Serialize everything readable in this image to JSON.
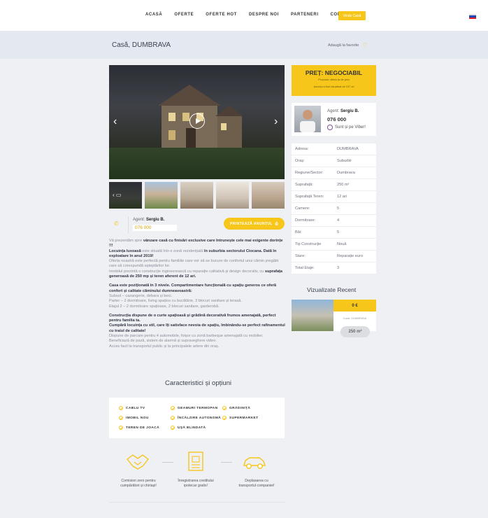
{
  "nav": {
    "items": [
      "ACASĂ",
      "OFERTE",
      "OFERTE HOT",
      "DESPRE NOI",
      "PARTENERI",
      "CONTACTE"
    ],
    "sell_button": "Vinde Casă",
    "flag_colors": [
      "#ffffff",
      "#1a47b8",
      "#e21c26"
    ]
  },
  "title": {
    "heading": "Casă, DUMBRAVA",
    "favorite_label": "Adaugă la favorite"
  },
  "agent": {
    "label": "Agent:",
    "name": "Sergiu B.",
    "phone": "076 000",
    "print_label": "PRINTEAZĂ ANUNȚUL"
  },
  "description": {
    "p1": [
      {
        "t": "Vă prezentăm spre ",
        "b": false
      },
      {
        "t": "vânzare casă cu finisări exclusive care întrunește cele mai exigente dorințe !!!",
        "b": true
      },
      {
        "t": "Locuința luxoasă",
        "b": true,
        "br": true
      },
      {
        "t": " este situată într-o zonă rezidențială ",
        "b": false
      },
      {
        "t": "în suburbia sectorului Ciocana. Dată în exploatare în anul 2019!",
        "b": true
      },
      {
        "t": "Oferta noastră este perfectă pentru familiile care vor să se bucure de confortul unui cămin pregătit care să corespundă așteptărilor lor.",
        "b": false,
        "br": true
      },
      {
        "t": "Imobilul prezintă o construcție ingineerească cu reparație calitativă și design decorativ, cu ",
        "b": false,
        "br": true
      },
      {
        "t": "suprafața generoasă de 250 mp și teren aferent de 12 ari.",
        "b": true
      }
    ],
    "p2": [
      {
        "t": "Casa este poziționată în 3 nivele. Compartimentare funcțională cu spațiu generos ce oferă confort și calitate căminului dumneavoastră:",
        "b": true
      },
      {
        "t": "Subsol – cazangerie, debara și beci.",
        "b": false,
        "br": true
      },
      {
        "t": "Parter – 2 dormitoare, living spațios cu bucătărie, 3 blocuri sanitare și terasă.",
        "b": false,
        "br": true
      },
      {
        "t": "Etajul 2 – 2 dormitoare spațioase, 2 blocuri sanitare, garderobă.",
        "b": false,
        "br": true
      }
    ],
    "p3": [
      {
        "t": "Construcția dispune de o curte spațioasă și grădină decorativă frumos amenajată, perfect pentru familia ta.",
        "b": true
      },
      {
        "t": "Cumpără locuința cu stil, care îți satisface nevoia de spațiu, îmbinându-se perfect rafinamentul cu traiul de calitate!",
        "b": true,
        "br": true
      },
      {
        "t": "Dispune de parcare pentru 4 automobile, foișor cu zonă barbeque amenajată cu mobilier.",
        "b": false,
        "br": true
      },
      {
        "t": "Beneficiază de pază, sistem de alarmă și supraveghere video.",
        "b": false,
        "br": true
      },
      {
        "t": "Acces facil la transportul public și la principalele artere din oraș.",
        "b": false,
        "br": true
      }
    ]
  },
  "price": {
    "title": "PREȚ: NEGOCIABIL",
    "subtitle": "Propune oferta ta de preț",
    "footnote": "Anunțul a fost vizualizat de 157 ori"
  },
  "agent_card": {
    "label": "Agent:",
    "name": "Sergiu B.",
    "phone": "076 000",
    "viber": "Sunt și pe Viber!"
  },
  "properties": [
    {
      "k": "Adresa:",
      "v": "DUMBRAVA"
    },
    {
      "k": "Oraș:",
      "v": "Suburbii"
    },
    {
      "k": "Regiune/Sector:",
      "v": "Dumbrava"
    },
    {
      "k": "Suprafață:",
      "v": "250 m²"
    },
    {
      "k": "Suprafață Teren:",
      "v": "12 ari"
    },
    {
      "k": "Camere:",
      "v": "5"
    },
    {
      "k": "Dormitoare:",
      "v": "4"
    },
    {
      "k": "Băi:",
      "v": "5"
    },
    {
      "k": "Tip Construcție",
      "v": "Nouă"
    },
    {
      "k": "Stare:",
      "v": "Reparație euro"
    },
    {
      "k": "Total Etaje:",
      "v": "3"
    }
  ],
  "recent": {
    "title": "Vizualizate Recent",
    "price": "0 €",
    "name": "Casă, DUMBRAVA",
    "area": "250 m²"
  },
  "features": {
    "title": "Caracteristici și opțiuni",
    "items": [
      "CABLU TV",
      "GEAMURI TERMOPAN",
      "GRĂDINIȚĂ",
      "IMOBIL NOU",
      "ÎNCĂLZIRE AUTONOMĂ",
      "SUPERMARKET",
      "TEREN DE JOACĂ",
      "UȘĂ BLINDATĂ"
    ]
  },
  "benefits": [
    {
      "text": "Comision zero pentru cumpărători și chiriași!",
      "icon": "handshake-icon"
    },
    {
      "text": "Înregistrarea creditului ipotecar gratis!",
      "icon": "document-icon"
    },
    {
      "text": "Deplasarea cu transportul companiei!",
      "icon": "car-icon"
    }
  ],
  "accent": "#f7c61b"
}
